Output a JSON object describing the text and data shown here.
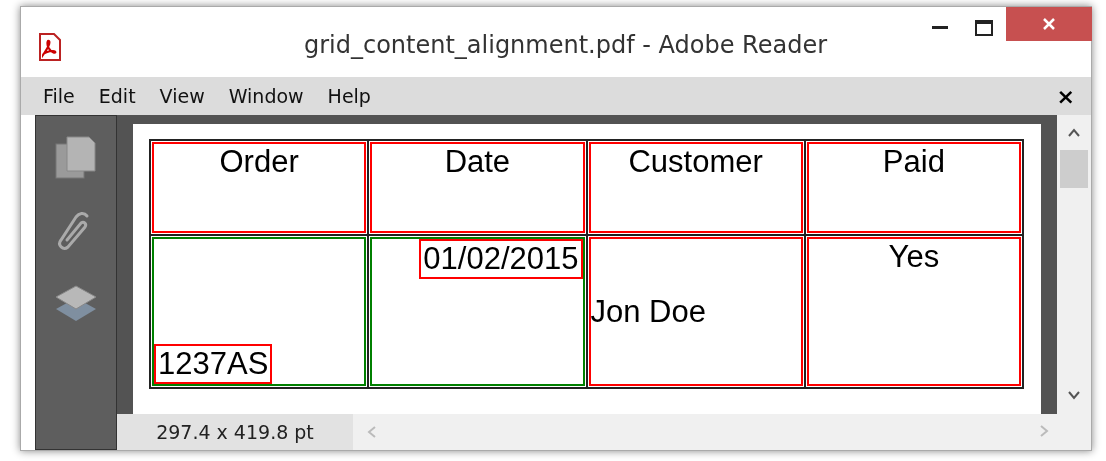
{
  "window": {
    "title": "grid_content_alignment.pdf - Adobe Reader"
  },
  "menu": [
    "File",
    "Edit",
    "View",
    "Window",
    "Help"
  ],
  "menu_close": "×",
  "table": {
    "rows": [
      [
        {
          "text": "Order",
          "color": "#ff0000",
          "kind": "topcenter",
          "framed": false
        },
        {
          "text": "Date",
          "color": "#ff0000",
          "kind": "topcenter",
          "framed": false
        },
        {
          "text": "Customer",
          "color": "#ff0000",
          "kind": "topcenter",
          "framed": false
        },
        {
          "text": "Paid",
          "color": "#ff0000",
          "kind": "topcenter",
          "framed": false
        }
      ],
      [
        {
          "text": "1237AS",
          "color": "#008000",
          "kind": "bottomleft",
          "framed": true
        },
        {
          "text": "01/02/2015",
          "color": "#008000",
          "kind": "topright",
          "framed": true
        },
        {
          "text": "Jon Doe",
          "color": "#ff0000",
          "kind": "middleleft",
          "framed": false
        },
        {
          "text": "Yes",
          "color": "#ff0000",
          "kind": "topcenter",
          "framed": false
        }
      ]
    ]
  },
  "status_bar": {
    "page_size": "297.4 x 419.8 pt"
  }
}
